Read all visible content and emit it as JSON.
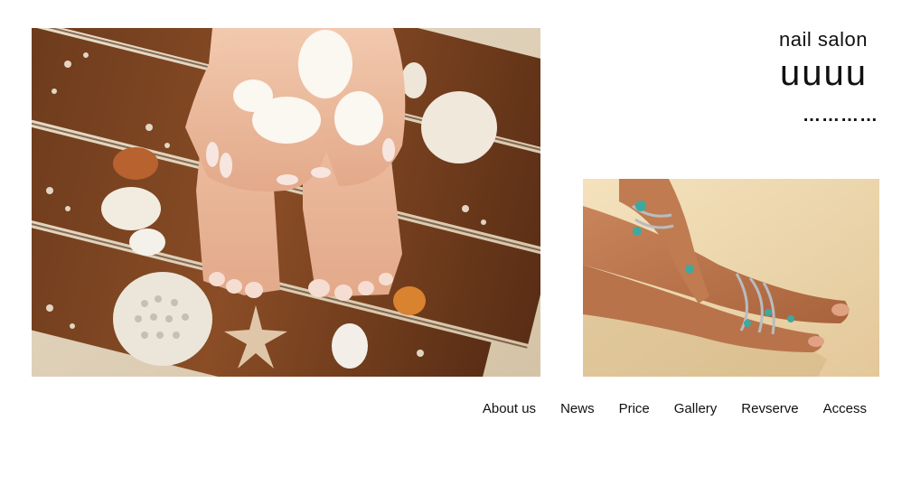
{
  "brand": {
    "tagline": "nail salon",
    "name": "uuuu",
    "dots": "…………"
  },
  "nav": {
    "items": [
      {
        "label": "About us"
      },
      {
        "label": "News"
      },
      {
        "label": "Price"
      },
      {
        "label": "Gallery"
      },
      {
        "label": "Revserve"
      },
      {
        "label": "Access"
      }
    ]
  }
}
